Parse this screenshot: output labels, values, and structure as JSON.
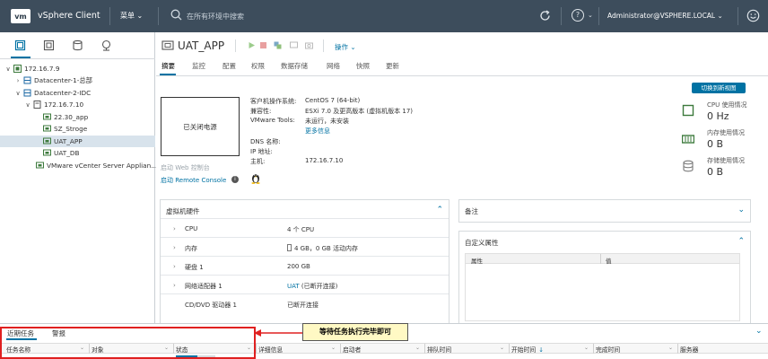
{
  "header": {
    "logo": "vm",
    "app_title": "vSphere Client",
    "menu_label": "菜单",
    "search_placeholder": "在所有环境中搜索",
    "help_label": "?",
    "user": "Administrator@VSPHERE.LOCAL"
  },
  "tree": [
    {
      "label": "172.16.7.9",
      "twisty": "∨",
      "icon": "vcenter-icon",
      "indent": 0
    },
    {
      "label": "Datacenter-1-总部",
      "twisty": "›",
      "icon": "datacenter-icon",
      "indent": 1
    },
    {
      "label": "Datacenter-2-IDC",
      "twisty": "∨",
      "icon": "datacenter-icon",
      "indent": 1
    },
    {
      "label": "172.16.7.10",
      "twisty": "∨",
      "icon": "host-icon",
      "indent": 2
    },
    {
      "label": "22.30_app",
      "twisty": "",
      "icon": "vm-icon",
      "indent": 3
    },
    {
      "label": "SZ_Stroge",
      "twisty": "",
      "icon": "vm-icon",
      "indent": 3
    },
    {
      "label": "UAT_APP",
      "twisty": "",
      "icon": "vm-icon",
      "indent": 3
    },
    {
      "label": "UAT_DB",
      "twisty": "",
      "icon": "vm-icon",
      "indent": 3
    },
    {
      "label": "VMware vCenter Server Applian...",
      "twisty": "",
      "icon": "vm-icon",
      "indent": 3
    }
  ],
  "object": {
    "title": "UAT_APP",
    "actions_label": "操作",
    "tabs": [
      "摘要",
      "监控",
      "配置",
      "权限",
      "数据存储",
      "网络",
      "快照",
      "更新"
    ]
  },
  "summary": {
    "switch_view": "切换到新视图",
    "thumbnail_text": "已关闭电源",
    "web_console": "启动 Web 控制台",
    "remote_console": "启动 Remote Console",
    "guest_os_label": "客户机操作系统:",
    "guest_os_value": "CentOS 7 (64-bit)",
    "compat_label": "兼容性:",
    "compat_value": "ESXi 7.0 及更高版本 (虚拟机版本 17)",
    "tools_label": "VMware Tools:",
    "tools_value": "未运行，未安装",
    "more_info": "更多信息",
    "dns_label": "DNS 名称:",
    "ip_label": "IP 地址:",
    "host_label": "主机:",
    "host_value": "172.16.7.10"
  },
  "stats": {
    "cpu_label": "CPU 使用情况",
    "cpu_value": "0 Hz",
    "mem_label": "内存使用情况",
    "mem_value": "0 B",
    "storage_label": "存储使用情况",
    "storage_value": "0 B"
  },
  "hardware": {
    "title": "虚拟机硬件",
    "rows": [
      {
        "name": "CPU",
        "value": "4 个 CPU",
        "arrow": "›"
      },
      {
        "name": "内存",
        "value": "4 GB，0 GB 活动内存",
        "arrow": "›"
      },
      {
        "name": "硬盘 1",
        "value": "200 GB",
        "arrow": "›"
      },
      {
        "name": "网络适配器 1",
        "value_link": "UAT",
        "value": "(已断开连接)",
        "arrow": "›"
      },
      {
        "name": "CD/DVD 驱动器 1",
        "value": "已断开连接",
        "arrow": ""
      }
    ]
  },
  "notes": {
    "title": "备注"
  },
  "custom_attrs": {
    "title": "自定义属性",
    "col_attr": "属性",
    "col_value": "值"
  },
  "tasks": {
    "tab_recent": "近期任务",
    "tab_alarms": "警报",
    "columns": [
      "任务名称",
      "对象",
      "状态",
      "详细信息",
      "启动者",
      "排队时间",
      "开始时间",
      "完成时间",
      "服务器"
    ],
    "start_sort": "↓"
  },
  "annotation": {
    "callout": "等待任务执行完毕即可"
  }
}
